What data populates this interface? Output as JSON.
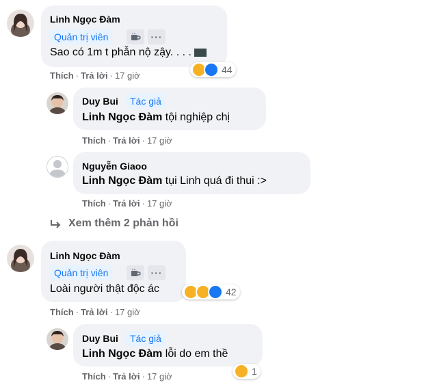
{
  "comments": [
    {
      "author": "Linh Ngọc Đàm",
      "badge": "Quản trị viên",
      "text": "Sao có 1m t phẫn nộ zậy. . . .",
      "actions": {
        "like": "Thích",
        "reply": "Trả lời",
        "time": "17 giờ"
      },
      "reactions": {
        "icons": [
          "haha-icon",
          "like-icon"
        ],
        "count": "44"
      },
      "replies": [
        {
          "author": "Duy Bui",
          "badge": "Tác giả",
          "mention": "Linh Ngọc Đàm",
          "text": "tội nghiệp chị",
          "actions": {
            "like": "Thích",
            "reply": "Trả lời",
            "time": "17 giờ"
          }
        },
        {
          "author": "Nguyễn Giaoo",
          "mention": "Linh Ngọc Đàm",
          "text": "tụi Linh quá đi thui :>",
          "actions": {
            "like": "Thích",
            "reply": "Trả lời",
            "time": "17 giờ"
          }
        }
      ],
      "see_more": "Xem thêm 2 phản hồi"
    },
    {
      "author": "Linh Ngọc Đàm",
      "badge": "Quản trị viên",
      "text": "Loài người thật độc ác",
      "actions": {
        "like": "Thích",
        "reply": "Trả lời",
        "time": "17 giờ"
      },
      "reactions": {
        "icons": [
          "haha-icon",
          "sad-icon",
          "like-icon"
        ],
        "count": "42"
      },
      "replies": [
        {
          "author": "Duy Bui",
          "badge": "Tác giả",
          "mention": "Linh Ngọc Đàm",
          "text": "lỗi do em thề",
          "actions": {
            "like": "Thích",
            "reply": "Trả lời",
            "time": "17 giờ"
          },
          "reactions": {
            "icons": [
              "haha-icon"
            ],
            "count": "1"
          }
        }
      ]
    }
  ],
  "colors": {
    "bubble": "#f0f2f5",
    "badge_bg": "#e7f3ff",
    "badge_text": "#1877f2",
    "meta": "#65676b",
    "like": "#1877f2",
    "haha": "#f7b125"
  }
}
